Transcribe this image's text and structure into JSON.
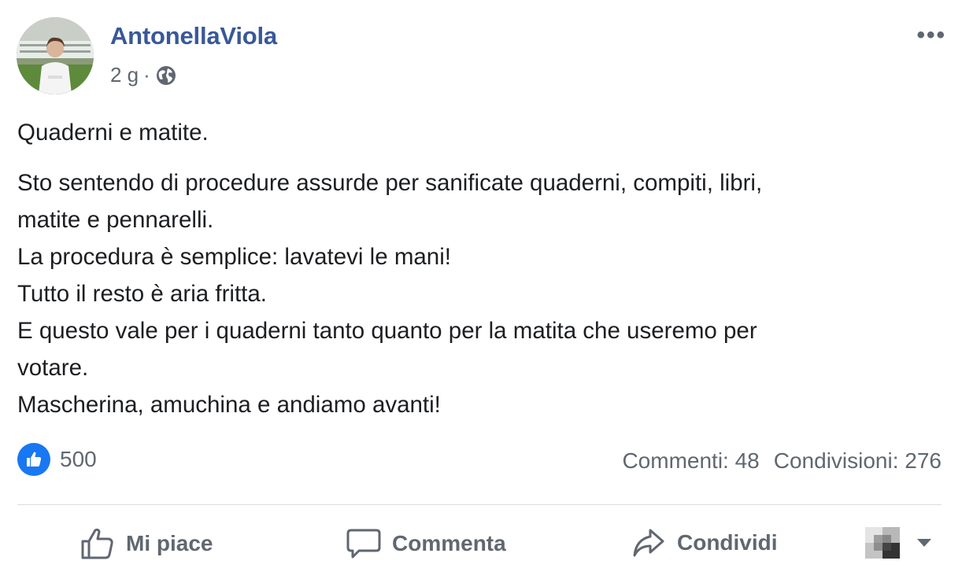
{
  "post": {
    "author": "AntonellaViola",
    "time": "2 g",
    "separator": "·",
    "audience_icon": "globe-icon",
    "more_icon": "•••",
    "title": "Quaderni e matite.",
    "lines": [
      "Sto sentendo di procedure assurde per sanificate quaderni, compiti, libri,",
      "matite e pennarelli.",
      "La procedura è semplice: lavatevi le mani!",
      "Tutto il resto è aria fritta.",
      "E questo vale per i quaderni tanto quanto per la matita che useremo per",
      "votare.",
      "Mascherina, amuchina e andiamo avanti!"
    ]
  },
  "stats": {
    "reaction_icon": "like-icon",
    "reactions": "500",
    "comments": "Commenti: 48",
    "shares": "Condivisioni: 276"
  },
  "actions": {
    "like": "Mi piace",
    "comment": "Commenta",
    "share": "Condividi"
  },
  "colors": {
    "author": "#385898",
    "like_blue": "#1877f2",
    "secondary_text": "#606770",
    "divider": "#dadde1"
  }
}
